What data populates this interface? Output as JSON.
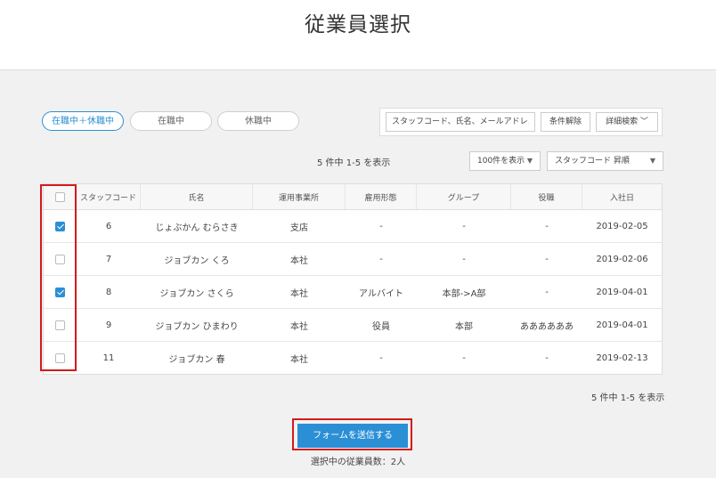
{
  "page": {
    "title": "従業員選択"
  },
  "filters": [
    {
      "label": "在職中＋休職中",
      "active": true
    },
    {
      "label": "在職中",
      "active": false
    },
    {
      "label": "休職中",
      "active": false
    }
  ],
  "search": {
    "placeholder": "スタッフコード、氏名、メールアドレス",
    "clear_label": "条件解除",
    "advanced_label": "詳細検索 ﹀"
  },
  "pagination": {
    "summary": "5 件中 1-5 を表示",
    "per_page": "100件を表示",
    "sort": "スタッフコード 昇順"
  },
  "table": {
    "columns": [
      "スタッフコード",
      "氏名",
      "運用事業所",
      "雇用形態",
      "グループ",
      "役職",
      "入社日"
    ],
    "rows": [
      {
        "checked": true,
        "code": "6",
        "name": "じょぶかん むらさき",
        "office": "支店",
        "employment": "-",
        "group": "-",
        "position": "-",
        "hire_date": "2019-02-05"
      },
      {
        "checked": false,
        "code": "7",
        "name": "ジョブカン くろ",
        "office": "本社",
        "employment": "-",
        "group": "-",
        "position": "-",
        "hire_date": "2019-02-06"
      },
      {
        "checked": true,
        "code": "8",
        "name": "ジョブカン さくら",
        "office": "本社",
        "employment": "アルバイト",
        "group": "本部->A部",
        "position": "-",
        "hire_date": "2019-04-01"
      },
      {
        "checked": false,
        "code": "9",
        "name": "ジョブカン ひまわり",
        "office": "本社",
        "employment": "役員",
        "group": "本部",
        "position": "ああああああ",
        "hire_date": "2019-04-01"
      },
      {
        "checked": false,
        "code": "11",
        "name": "ジョブカン 春",
        "office": "本社",
        "employment": "-",
        "group": "-",
        "position": "-",
        "hire_date": "2019-02-13"
      }
    ]
  },
  "footer": {
    "summary": "5 件中 1-5 を表示",
    "submit_label": "フォームを送信する",
    "selected_count": "選択中の従業員数：2人"
  },
  "colors": {
    "accent": "#2b8fd6",
    "highlight": "#d41a1a"
  }
}
